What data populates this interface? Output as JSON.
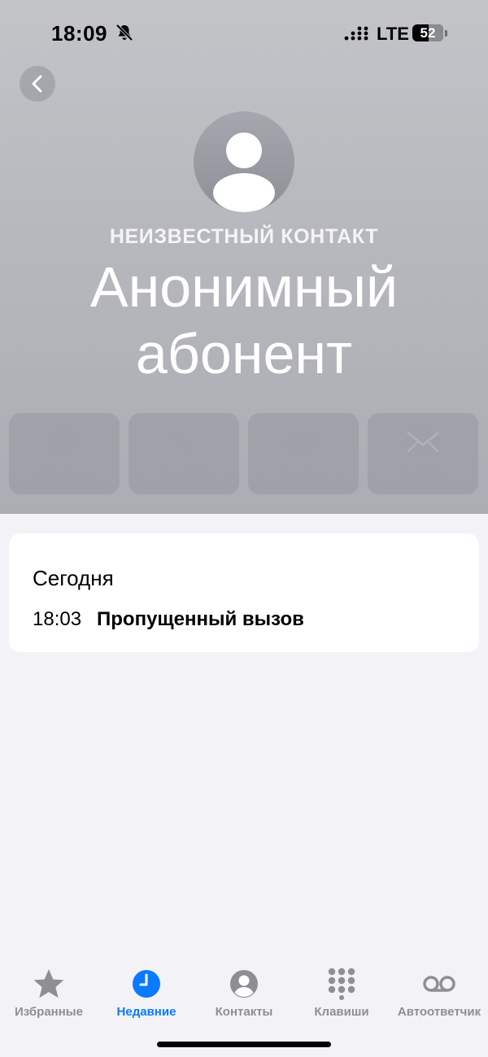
{
  "status_bar": {
    "time": "18:09",
    "network": "LTE",
    "battery_level": "52"
  },
  "contact": {
    "caption": "НЕИЗВЕСТНЫЙ КОНТАКТ",
    "name": "Анонимный абонент"
  },
  "actions": [
    {
      "label": "напис...",
      "icon": "message-bubble-icon"
    },
    {
      "label": "вызов",
      "icon": "phone-icon"
    },
    {
      "label": "видео",
      "icon": "video-camera-icon"
    },
    {
      "label": "почта",
      "icon": "envelope-icon"
    }
  ],
  "recents": {
    "day": "Сегодня",
    "entries": [
      {
        "time": "18:03",
        "status": "Пропущенный вызов"
      }
    ]
  },
  "tab_bar": {
    "tabs": [
      {
        "label": "Избранные",
        "icon": "star-icon",
        "active": false
      },
      {
        "label": "Недавние",
        "icon": "clock-icon",
        "active": true
      },
      {
        "label": "Контакты",
        "icon": "person-circle-icon",
        "active": false
      },
      {
        "label": "Клавиши",
        "icon": "keypad-icon",
        "active": false
      },
      {
        "label": "Автоответчик",
        "icon": "voicemail-icon",
        "active": false
      }
    ]
  },
  "colors": {
    "accent": "#0a7aff",
    "tab_inactive": "#8e8e93",
    "background": "#f2f2f7"
  }
}
